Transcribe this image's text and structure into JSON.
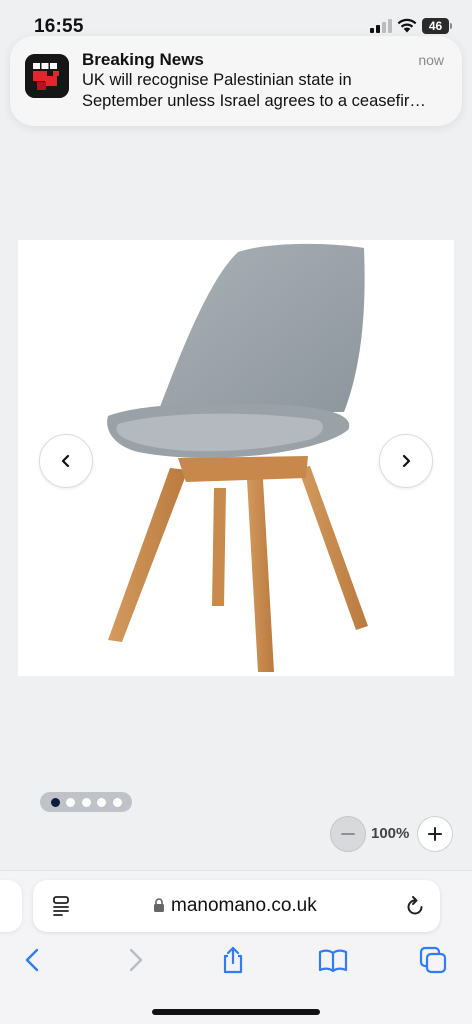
{
  "status_bar": {
    "time": "16:55",
    "battery_level": "46"
  },
  "notification": {
    "app_icon": "bbc-news-icon",
    "title": "Breaking News",
    "time": "now",
    "body_line1": "UK will recognise Palestinian state in",
    "body_line2": "September unless Israel agrees to a ceasefir…"
  },
  "product": {
    "image": "grey-chair-wooden-legs",
    "prev_icon": "chevron-left-icon",
    "next_icon": "chevron-right-icon",
    "pagination": {
      "total": 5,
      "active": 1
    }
  },
  "zoom": {
    "level": "100%"
  },
  "browser": {
    "url": "manomano.co.uk",
    "icons": [
      "reader-icon",
      "lock-icon",
      "reload-icon",
      "back-icon",
      "forward-icon",
      "share-icon",
      "bookmarks-icon",
      "tabs-icon"
    ],
    "accent": "#2f7cf6"
  }
}
